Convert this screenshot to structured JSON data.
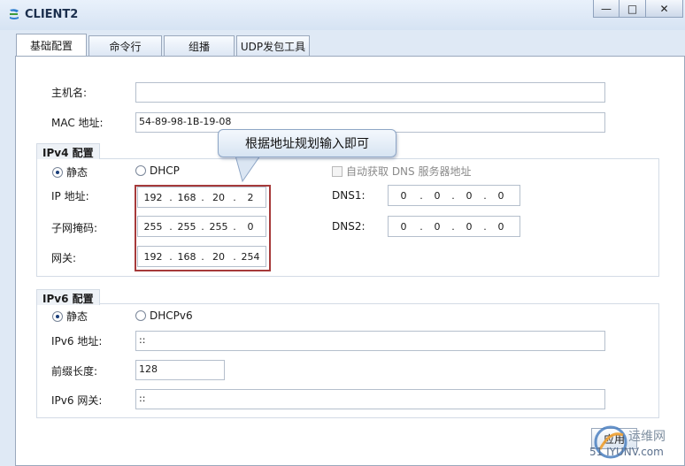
{
  "window": {
    "title": "CLIENT2"
  },
  "tabs": [
    {
      "label": "基础配置"
    },
    {
      "label": "命令行"
    },
    {
      "label": "组播"
    },
    {
      "label": "UDP发包工具"
    }
  ],
  "basic": {
    "hostname_label": "主机名:",
    "hostname_value": "",
    "mac_label": "MAC 地址:",
    "mac_value": "54-89-98-1B-19-08"
  },
  "ipv4": {
    "group_title": "IPv4 配置",
    "static_label": "静态",
    "dhcp_label": "DHCP",
    "selected_mode": "static",
    "auto_dns_label": "自动获取 DNS 服务器地址",
    "auto_dns_checked": false,
    "ip_label": "IP 地址:",
    "ip": [
      "192",
      "168",
      "20",
      "2"
    ],
    "mask_label": "子网掩码:",
    "mask": [
      "255",
      "255",
      "255",
      "0"
    ],
    "gateway_label": "网关:",
    "gateway": [
      "192",
      "168",
      "20",
      "254"
    ],
    "dns1_label": "DNS1:",
    "dns1": [
      "0",
      "0",
      "0",
      "0"
    ],
    "dns2_label": "DNS2:",
    "dns2": [
      "0",
      "0",
      "0",
      "0"
    ]
  },
  "ipv6": {
    "group_title": "IPv6 配置",
    "static_label": "静态",
    "dhcp_label": "DHCPv6",
    "selected_mode": "static",
    "ip_label": "IPv6 地址:",
    "ip_value": "::",
    "prefix_label": "前缀长度:",
    "prefix_value": "128",
    "gateway_label": "IPv6 网关:",
    "gateway_value": "::"
  },
  "callout": {
    "text": "根据地址规划输入即可"
  },
  "apply_button": {
    "label": "应用"
  },
  "watermark": {
    "line1": "运维网",
    "line2": "51 IYUNV.com"
  },
  "colors": {
    "highlight_border": "#a63a3a",
    "panel_bg": "#dfe9f5"
  }
}
